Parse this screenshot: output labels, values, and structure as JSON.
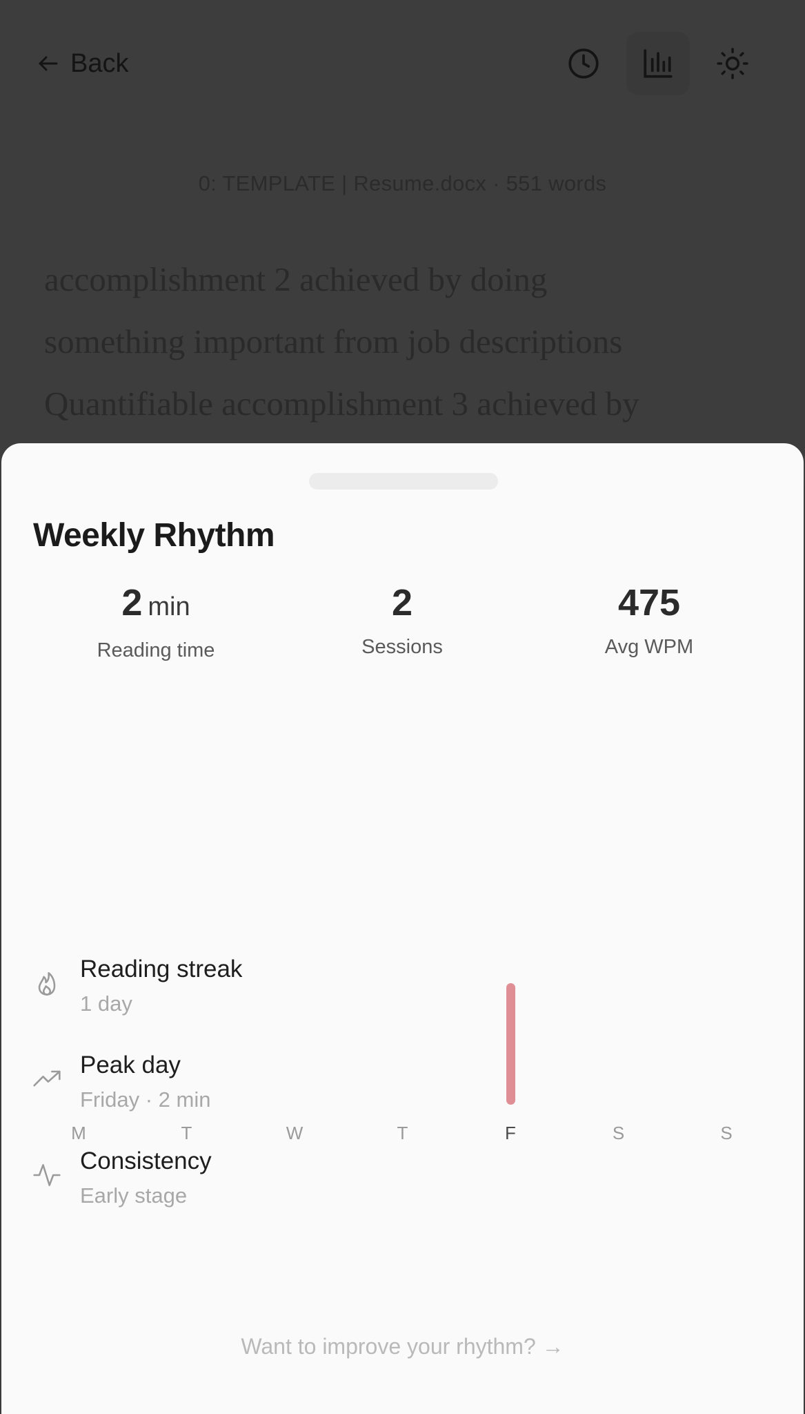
{
  "header": {
    "back_label": "Back"
  },
  "document": {
    "meta": "0: TEMPLATE | Resume.docx · 551 words",
    "lines": [
      "accomplishment 2 achieved by doing",
      "something important from job descriptions",
      "Quantifiable accomplishment 3 achieved by"
    ]
  },
  "sheet": {
    "title": "Weekly Rhythm",
    "stats": [
      {
        "value": "2",
        "unit": "min",
        "label": "Reading time"
      },
      {
        "value": "2",
        "unit": "",
        "label": "Sessions"
      },
      {
        "value": "475",
        "unit": "",
        "label": "Avg WPM"
      }
    ],
    "insights": [
      {
        "icon": "flame-icon",
        "title": "Reading streak",
        "value": "1 day"
      },
      {
        "icon": "trending-up-icon",
        "title": "Peak day",
        "value": "Friday · 2 min"
      },
      {
        "icon": "activity-icon",
        "title": "Consistency",
        "value": "Early stage"
      }
    ],
    "cta": "Want to improve your rhythm? →"
  },
  "chart_data": {
    "type": "bar",
    "categories": [
      "M",
      "T",
      "W",
      "T",
      "F",
      "S",
      "S"
    ],
    "values": [
      0,
      0,
      0,
      0,
      2,
      0,
      0
    ],
    "highlight_index": 4,
    "bar_color": "#e08e95"
  }
}
